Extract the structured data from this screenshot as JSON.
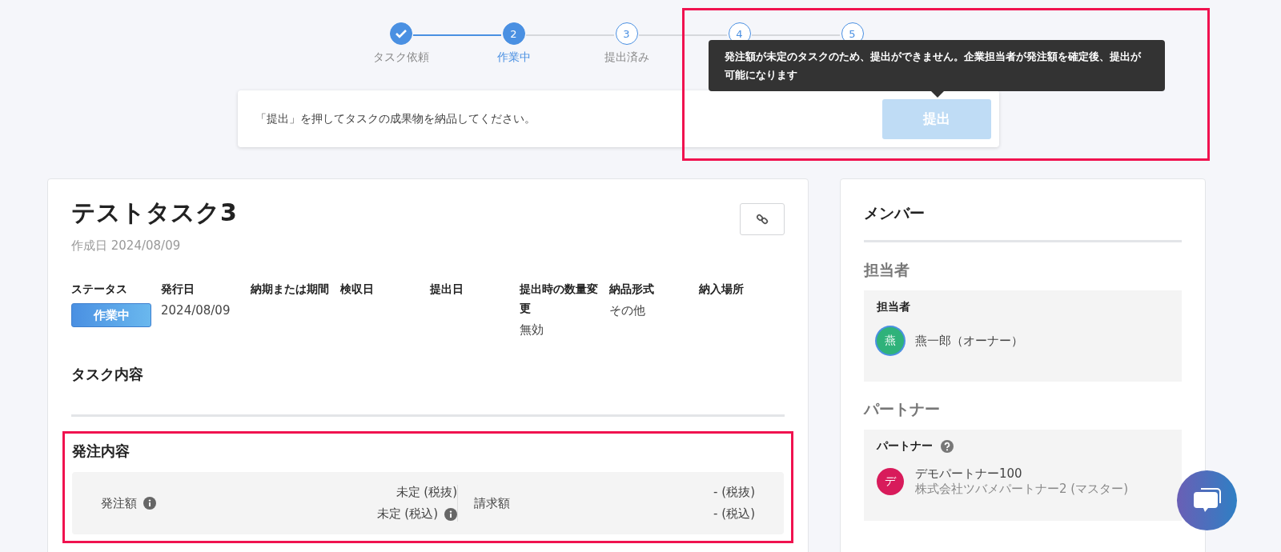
{
  "stepper": [
    {
      "label": "タスク依頼",
      "done": true,
      "selected": false
    },
    {
      "number": "2",
      "label": "作業中",
      "done": false,
      "selected": true
    },
    {
      "number": "3",
      "label": "提出済み",
      "done": false,
      "selected": false
    },
    {
      "number": "4",
      "done": false,
      "selected": false
    },
    {
      "number": "5",
      "done": false,
      "selected": false
    }
  ],
  "tooltip": {
    "text": "発注額が未定のタスクのため、提出ができません。企業担当者が発注額を確定後、提出が可能になります",
    "highlighted": true
  },
  "instruction": {
    "text": "「提出」を押してタスクの成果物を納品してください。",
    "button": {
      "label": "提出",
      "disabled": true
    }
  },
  "task": {
    "title": "テストタスク3",
    "created": "作成日 2024/08/09",
    "fields": [
      {
        "label": "ステータス",
        "value": "作業中",
        "kind": "badge"
      },
      {
        "label": "発行日",
        "value": "2024/08/09",
        "kind": "text"
      },
      {
        "label": "納期または期間"
      },
      {
        "label": "検収日"
      },
      {
        "label": "提出日"
      },
      {
        "label": "提出時の数量変更",
        "value": "無効",
        "kind": "text"
      },
      {
        "label": "納品形式",
        "value": "その他",
        "kind": "text"
      },
      {
        "label": "納入場所"
      }
    ],
    "content_heading": "タスク内容",
    "order": {
      "heading": "発注内容",
      "highlighted": true,
      "amount_label": "発注額",
      "amount_excl": "未定 (税抜)",
      "amount_incl": "未定 (税込)",
      "billing_label": "請求額",
      "billing_excl": "- (税抜)",
      "billing_incl": "- (税込)"
    }
  },
  "members": {
    "title": "メンバー",
    "sections": [
      {
        "heading": "担当者",
        "box_label": "担当者",
        "people": [
          {
            "avatar": "燕",
            "name": "燕一郎（オーナー）",
            "color": "#2fb27a"
          }
        ]
      },
      {
        "heading": "パートナー",
        "box_label": "パートナー",
        "help": true,
        "people": [
          {
            "avatar": "デ",
            "name": "デモパートナー100",
            "sub": "株式会社ツバメパートナー2 (マスター)",
            "color": "#d81b5b"
          }
        ]
      }
    ]
  }
}
